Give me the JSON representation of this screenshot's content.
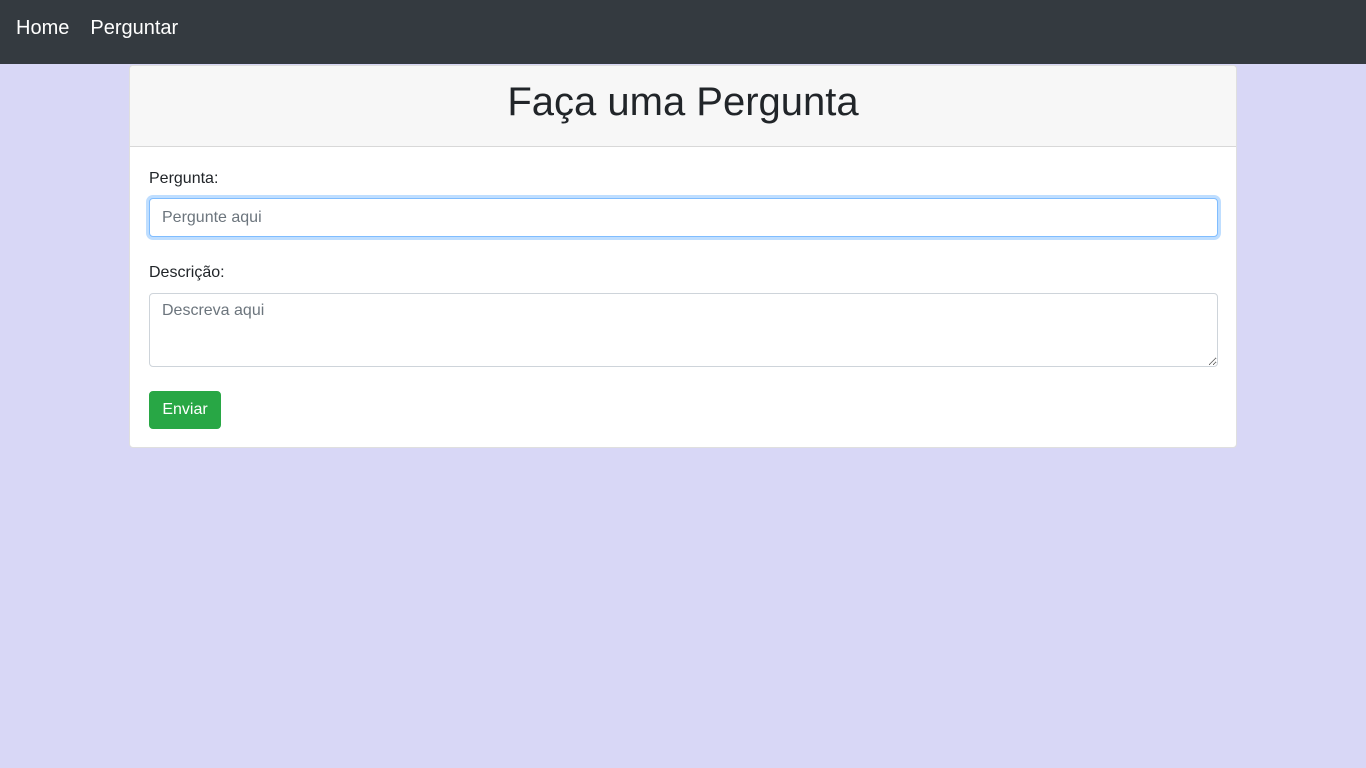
{
  "navbar": {
    "items": [
      {
        "label": "Home"
      },
      {
        "label": "Perguntar"
      }
    ]
  },
  "card": {
    "title": "Faça uma Pergunta"
  },
  "form": {
    "pergunta_label": "Pergunta:",
    "pergunta_placeholder": "Pergunte aqui",
    "pergunta_value": "",
    "descricao_label": "Descrição:",
    "descricao_placeholder": "Descreva aqui",
    "descricao_value": "",
    "submit_label": "Enviar"
  },
  "colors": {
    "navbar_bg": "#343a40",
    "page_bg": "#d8d7f6",
    "submit_bg": "#28a745",
    "focus_border": "#80bdff"
  }
}
